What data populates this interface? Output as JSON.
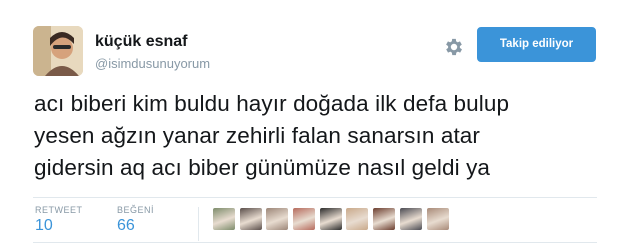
{
  "author": {
    "display_name": "küçük esnaf",
    "username": "@isimdusunuyorum"
  },
  "header": {
    "follow_label": "Takip ediliyor"
  },
  "tweet": {
    "text": "acı biberi kim buldu hayır doğada ilk defa bulup\nyesen ağzın yanar zehirli falan sanarsın atar\ngidersin aq acı biber günümüze nasıl geldi ya"
  },
  "stats": {
    "retweet_label": "RETWEET",
    "retweet_count": "10",
    "like_label": "BEĞENİ",
    "like_count": "66"
  },
  "colors": {
    "accent": "#3b94d9",
    "muted": "#8899a6",
    "text": "#14171a",
    "divider": "#e1e8ed"
  },
  "likers": [
    {
      "icon": "liker-avatar-1",
      "color": "#7d8c6b"
    },
    {
      "icon": "liker-avatar-2",
      "color": "#5a4e4a"
    },
    {
      "icon": "liker-avatar-3",
      "color": "#9c8678"
    },
    {
      "icon": "liker-avatar-4",
      "color": "#b66a5c"
    },
    {
      "icon": "liker-avatar-5",
      "color": "#2b2b2b"
    },
    {
      "icon": "liker-avatar-6",
      "color": "#c9a98a"
    },
    {
      "icon": "liker-avatar-7",
      "color": "#6b3d2e"
    },
    {
      "icon": "liker-avatar-8",
      "color": "#4a4a52"
    },
    {
      "icon": "liker-avatar-9",
      "color": "#a88a78"
    }
  ]
}
